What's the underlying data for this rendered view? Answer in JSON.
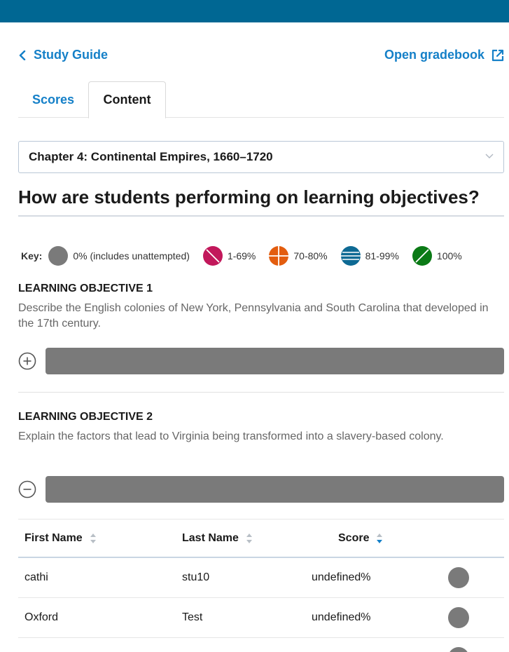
{
  "colors": {
    "topbar": "#006793",
    "link": "#1580c8",
    "grey": "#7a7a7a",
    "red": "#c2185b",
    "orange": "#e35d0f",
    "blue": "#0e6a94",
    "green": "#0b7a16"
  },
  "nav": {
    "back_label": "Study Guide",
    "back_icon": "chevron-left-icon",
    "gradebook_label": "Open gradebook",
    "gradebook_icon": "external-link-icon"
  },
  "tabs": [
    {
      "label": "Scores",
      "active": false
    },
    {
      "label": "Content",
      "active": true
    }
  ],
  "chapter_select": {
    "value": "Chapter 4: Continental Empires, 1660–1720",
    "icon": "chevron-down-icon"
  },
  "heading": "How are students performing on learning objectives?",
  "key": {
    "label": "Key:",
    "items": [
      {
        "label": "0% (includes unattempted)",
        "icon": "grey-circle-icon"
      },
      {
        "label": "1-69%",
        "icon": "red-slash-circle-icon"
      },
      {
        "label": "70-80%",
        "icon": "orange-cross-circle-icon"
      },
      {
        "label": "81-99%",
        "icon": "blue-striped-circle-icon"
      },
      {
        "label": "100%",
        "icon": "green-slash-circle-icon"
      }
    ]
  },
  "objectives": [
    {
      "title": "LEARNING OBJECTIVE 1",
      "description": "Describe the English colonies of New York, Pennsylvania and South Carolina that developed in the 17th century.",
      "toggle_icon": "plus-circle-icon"
    },
    {
      "title": "LEARNING OBJECTIVE 2",
      "description": "Explain the factors that lead to Virginia being transformed into a slavery-based colony.",
      "toggle_icon": "minus-circle-icon"
    }
  ],
  "table": {
    "columns": [
      "First Name",
      "Last Name",
      "Score"
    ],
    "rows": [
      {
        "first": "cathi",
        "last": "stu10",
        "score": "undefined%"
      },
      {
        "first": "Oxford",
        "last": "Test",
        "score": "undefined%"
      }
    ]
  }
}
